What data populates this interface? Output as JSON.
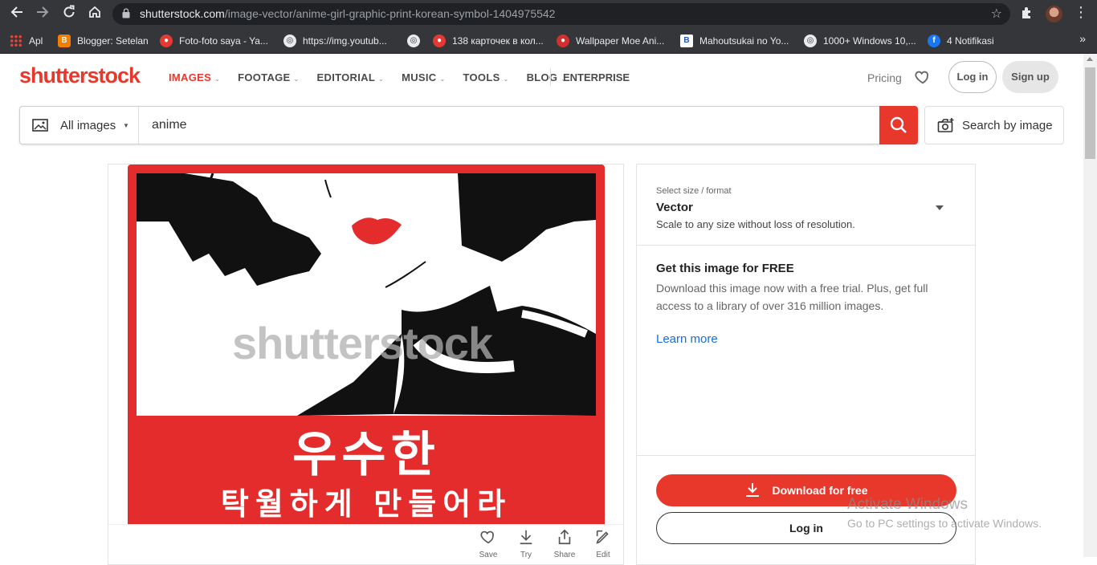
{
  "browser": {
    "url_host": "shutterstock.com",
    "url_path": "/image-vector/anime-girl-graphic-print-korean-symbol-1404975542",
    "bookmarks": [
      {
        "label": "Apl",
        "icon": "apps-grid-icon"
      },
      {
        "label": "Blogger: Setelan",
        "icon": "blogger-icon"
      },
      {
        "label": "Foto-foto saya - Ya...",
        "icon": "red-circle-icon"
      },
      {
        "label": "https://img.youtub...",
        "icon": "globe-icon"
      },
      {
        "label": "",
        "icon": "globe-icon"
      },
      {
        "label": "138 карточек в кол...",
        "icon": "red-circle-icon"
      },
      {
        "label": "Wallpaper Moe Ani...",
        "icon": "apple-icon"
      },
      {
        "label": "Mahoutsukai no Yo...",
        "icon": "b-letter-icon"
      },
      {
        "label": "1000+ Windows 10,...",
        "icon": "globe-icon"
      },
      {
        "label": "4 Notifikasi",
        "icon": "facebook-icon"
      }
    ]
  },
  "header": {
    "logo": "shutterstock",
    "nav": [
      {
        "label": "IMAGES",
        "active": true
      },
      {
        "label": "FOOTAGE",
        "active": false
      },
      {
        "label": "EDITORIAL",
        "active": false
      },
      {
        "label": "MUSIC",
        "active": false
      },
      {
        "label": "TOOLS",
        "active": false
      },
      {
        "label": "BLOG",
        "active": false
      }
    ],
    "enterprise": "ENTERPRISE",
    "pricing": "Pricing",
    "login": "Log in",
    "signup": "Sign up"
  },
  "search": {
    "scope": "All images",
    "query": "anime",
    "search_by_image": "Search by image"
  },
  "image": {
    "watermark": "shutterstock",
    "korean_title": "우수한",
    "korean_subtitle": "탁월하게 만들어라",
    "actions": [
      "Save",
      "Try",
      "Share",
      "Edit"
    ]
  },
  "panel": {
    "size_label": "Select size / format",
    "format": "Vector",
    "format_desc": "Scale to any size without loss of resolution.",
    "free_heading": "Get this image for FREE",
    "free_text": "Download this image now with a free trial. Plus, get full access to a library of over 316 million images.",
    "learn_more": "Learn more",
    "download": "Download for free",
    "login": "Log in"
  },
  "overlay": {
    "activate_title": "Activate Windows",
    "activate_sub": "Go to PC settings to activate Windows."
  },
  "colors": {
    "brand": "#e8382c",
    "link": "#1a6ed8",
    "chrome": "#35363a"
  }
}
